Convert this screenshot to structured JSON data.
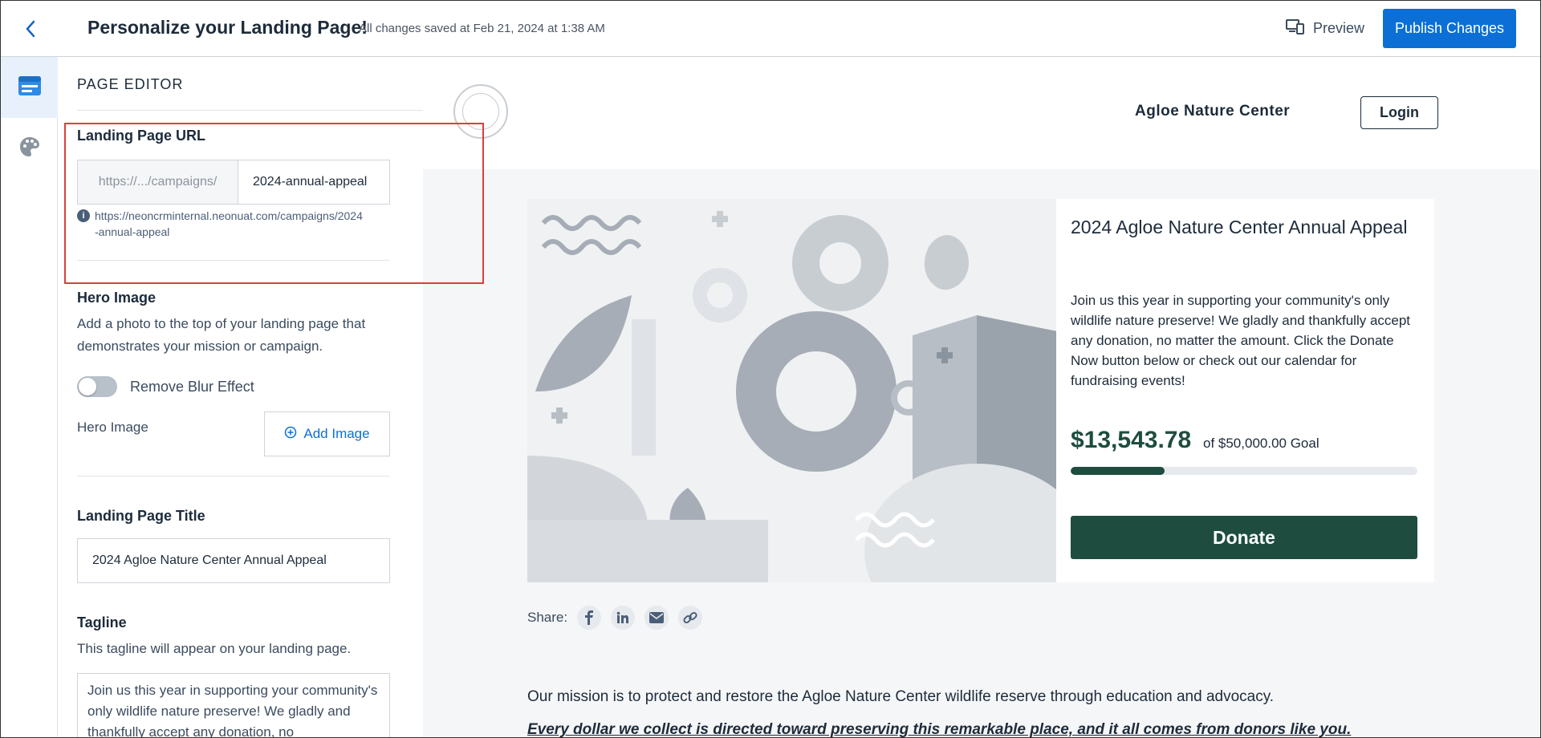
{
  "header": {
    "title": "Personalize your Landing Page!",
    "saved_status": "All changes saved at Feb 21, 2024 at 1:38 AM",
    "preview_label": "Preview",
    "publish_label": "Publish Changes"
  },
  "rail": {
    "items": [
      {
        "icon": "page-layout-icon",
        "active": true
      },
      {
        "icon": "palette-icon",
        "active": false
      }
    ]
  },
  "editor": {
    "heading": "PAGE EDITOR",
    "url_section": {
      "label": "Landing Page URL",
      "prefix": "https://.../campaigns/",
      "slug": "2024-annual-appeal",
      "full_url_line1": "https://neoncrminternal.neonuat.com/campaigns/2024",
      "full_url_line2": "-annual-appeal"
    },
    "hero_section": {
      "label": "Hero Image",
      "description": "Add a photo to the top of your landing page that demonstrates your mission or campaign.",
      "blur_toggle_label": "Remove Blur Effect",
      "blur_toggle_on": false,
      "image_label": "Hero Image",
      "add_image_label": "Add Image"
    },
    "title_section": {
      "label": "Landing Page Title",
      "value": "2024 Agloe Nature Center Annual Appeal"
    },
    "tagline_section": {
      "label": "Tagline",
      "description": "This tagline will appear on your landing page.",
      "value": "Join us this year in supporting your community's only wildlife nature preserve! We gladly and thankfully accept any donation, no"
    }
  },
  "preview": {
    "org_name": "Agloe Nature Center",
    "login_label": "Login",
    "campaign_title": "2024 Agloe Nature Center Annual Appeal",
    "campaign_tagline": "Join us this year in supporting your community's only wildlife nature preserve! We gladly and thankfully accept any donation, no matter the amount. Click the Donate Now button below or check out our calendar for fundraising events!",
    "amount_raised": "$13,543.78",
    "goal_text": "of $50,000.00 Goal",
    "progress_fraction": 0.27,
    "donate_label": "Donate",
    "share_label": "Share:",
    "share_icons": [
      "facebook-icon",
      "linkedin-icon",
      "email-icon",
      "link-icon"
    ],
    "mission": "Our mission is to protect and restore the Agloe Nature Center wildlife reserve through education and advocacy.",
    "emphasis": "Every dollar we collect is directed toward preserving this remarkable place, and it all comes from donors like you."
  },
  "colors": {
    "brand_blue": "#0b6fd6",
    "brand_green": "#1e4d3f",
    "highlight_red": "#d9403b"
  }
}
